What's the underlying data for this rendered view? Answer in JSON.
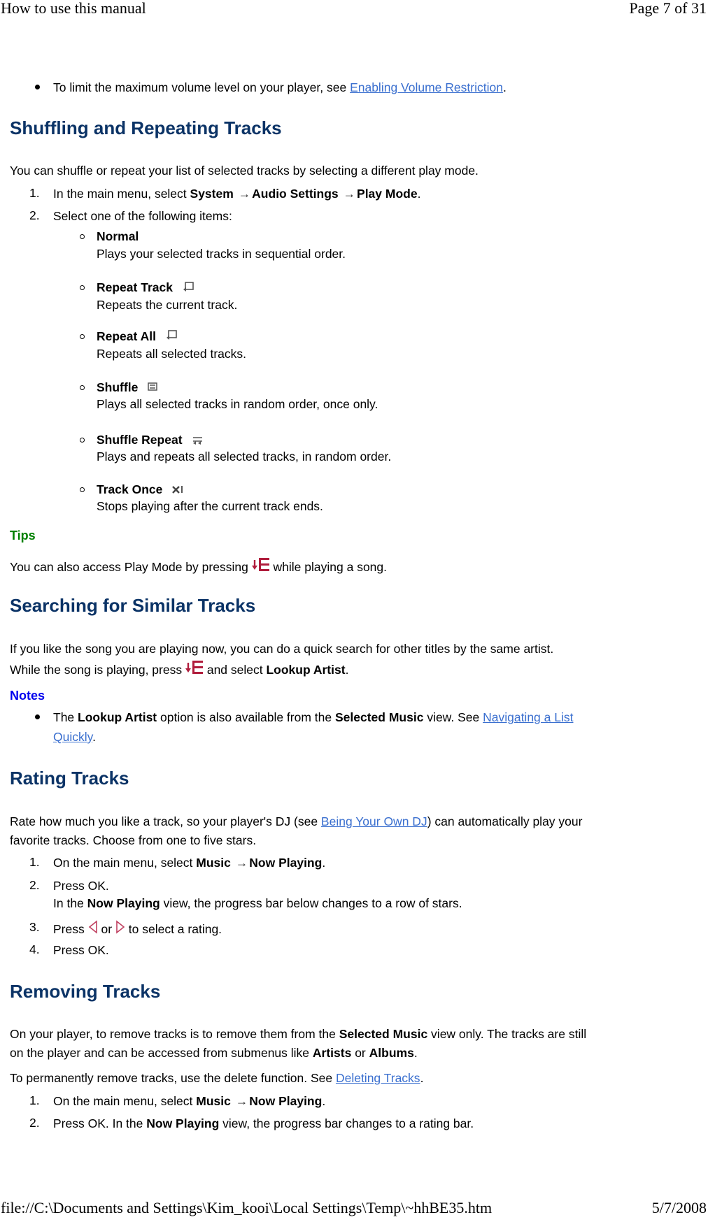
{
  "header": {
    "title": "How to use this manual",
    "page": "Page 7 of 31"
  },
  "footer": {
    "path": "file://C:\\Documents and Settings\\Kim_kooi\\Local Settings\\Temp\\~hhBE35.htm",
    "date": "5/7/2008"
  },
  "intro_bullet": {
    "text": "To limit the maximum volume level on your player, see ",
    "link": "Enabling Volume Restriction",
    "end": "."
  },
  "shuffle": {
    "heading": "Shuffling and Repeating Tracks",
    "intro": "You can shuffle or repeat your list of selected tracks by selecting a different play mode.",
    "step1": {
      "num": "1.",
      "pre": "In the main menu, select ",
      "b1": "System",
      "arrow": "→",
      "b2": "Audio Settings",
      "b3": "Play Mode",
      "end": "."
    },
    "step2": {
      "num": "2.",
      "text": "Select one of the following items:"
    },
    "modes": [
      {
        "title": "Normal",
        "desc": "Plays your selected tracks in sequential order.",
        "icon": "none"
      },
      {
        "title": "Repeat Track",
        "desc": "Repeats the current track.",
        "icon": "repeat-track-icon"
      },
      {
        "title": "Repeat All",
        "desc": "Repeats all selected tracks.",
        "icon": "repeat-all-icon"
      },
      {
        "title": "Shuffle",
        "desc": "Plays all selected tracks in random order, once only.",
        "icon": "shuffle-icon"
      },
      {
        "title": "Shuffle Repeat",
        "desc": "Plays and repeats all selected tracks, in random order.",
        "icon": "shuffle-repeat-icon"
      },
      {
        "title": "Track Once",
        "desc": "Stops playing after the current track ends.",
        "icon": "track-once-icon"
      }
    ],
    "tips_label": "Tips",
    "tips_pre": "You can also access Play Mode by pressing ",
    "tips_post": " while playing a song."
  },
  "searching": {
    "heading": "Searching for Similar Tracks",
    "line1": "If you like the song you are playing now, you can do a quick search for other titles by the same artist.",
    "line2_pre": "While the song is playing, press ",
    "line2_mid": " and select ",
    "line2_bold": "Lookup Artist",
    "line2_end": ".",
    "notes_label": "Notes",
    "note": {
      "pre": "The ",
      "b1": "Lookup Artist",
      "mid": " option is also available from the ",
      "b2": "Selected Music",
      "post": " view. See ",
      "link1": "Navigating a List",
      "link2": "Quickly",
      "end": "."
    }
  },
  "rating": {
    "heading": "Rating Tracks",
    "p1_pre": "Rate how much you like a track, so your player's DJ (see ",
    "p1_link": "Being Your Own DJ",
    "p1_post": ") can automatically play your",
    "p1_line2": "favorite tracks. Choose from one to five stars.",
    "step1": {
      "num": "1.",
      "pre": "On the main menu, select ",
      "b1": "Music",
      "arrow": "→",
      "b2": "Now Playing",
      "end": "."
    },
    "step2": {
      "num": "2.",
      "text": "Press OK.",
      "sub_pre": "In the ",
      "sub_b": "Now Playing",
      "sub_post": " view, the progress bar below changes to a row of stars."
    },
    "step3": {
      "num": "3.",
      "pre": "Press ",
      "or": " or ",
      "post": " to select a rating."
    },
    "step4": {
      "num": "4.",
      "text": "Press OK."
    }
  },
  "removing": {
    "heading": "Removing Tracks",
    "p1_pre": "On your player, to remove tracks is to remove them from the ",
    "p1_b": "Selected Music",
    "p1_post": " view only. The tracks are still",
    "p1_line2_pre": "on the player and can be accessed from submenus like ",
    "p1_b2": "Artists",
    "p1_or": " or ",
    "p1_b3": "Albums",
    "p1_end": ".",
    "p2_pre": "To permanently remove tracks, use the delete function. See ",
    "p2_link": "Deleting Tracks",
    "p2_end": ".",
    "step1": {
      "num": "1.",
      "pre": "On the main menu, select ",
      "b1": "Music",
      "arrow": "→",
      "b2": "Now Playing",
      "end": "."
    },
    "step2": {
      "num": "2.",
      "pre": "Press OK. In the ",
      "b": "Now Playing",
      "post": " view, the progress bar changes to a rating bar."
    }
  }
}
